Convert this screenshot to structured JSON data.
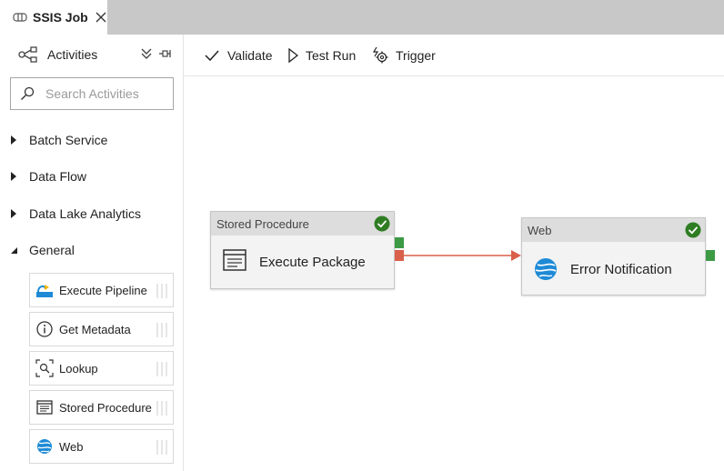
{
  "tab": {
    "title": "SSIS Job"
  },
  "sidebar": {
    "title": "Activities",
    "search_placeholder": "Search Activities",
    "categories": [
      {
        "label": "Batch Service",
        "expanded": false
      },
      {
        "label": "Data Flow",
        "expanded": false
      },
      {
        "label": "Data Lake Analytics",
        "expanded": false
      },
      {
        "label": "General",
        "expanded": true
      }
    ],
    "general_items": [
      {
        "label": "Execute Pipeline",
        "icon": "execute-pipeline-icon"
      },
      {
        "label": "Get Metadata",
        "icon": "info-icon"
      },
      {
        "label": "Lookup",
        "icon": "lookup-icon"
      },
      {
        "label": "Stored Procedure",
        "icon": "stored-procedure-icon"
      },
      {
        "label": "Web",
        "icon": "web-icon"
      }
    ]
  },
  "toolbar": {
    "validate_label": "Validate",
    "test_run_label": "Test Run",
    "trigger_label": "Trigger"
  },
  "canvas": {
    "nodes": [
      {
        "type": "Stored Procedure",
        "name": "Execute Package",
        "status": "succeeded",
        "icon": "stored-procedure-icon"
      },
      {
        "type": "Web",
        "name": "Error Notification",
        "status": "succeeded",
        "icon": "web-icon"
      }
    ],
    "connection": {
      "from": "Execute Package",
      "to": "Error Notification",
      "kind": "failure"
    }
  },
  "colors": {
    "success": "#3c9a45",
    "failure": "#d9604a",
    "check": "#2f7d23",
    "web_blue": "#1e8ad6"
  }
}
